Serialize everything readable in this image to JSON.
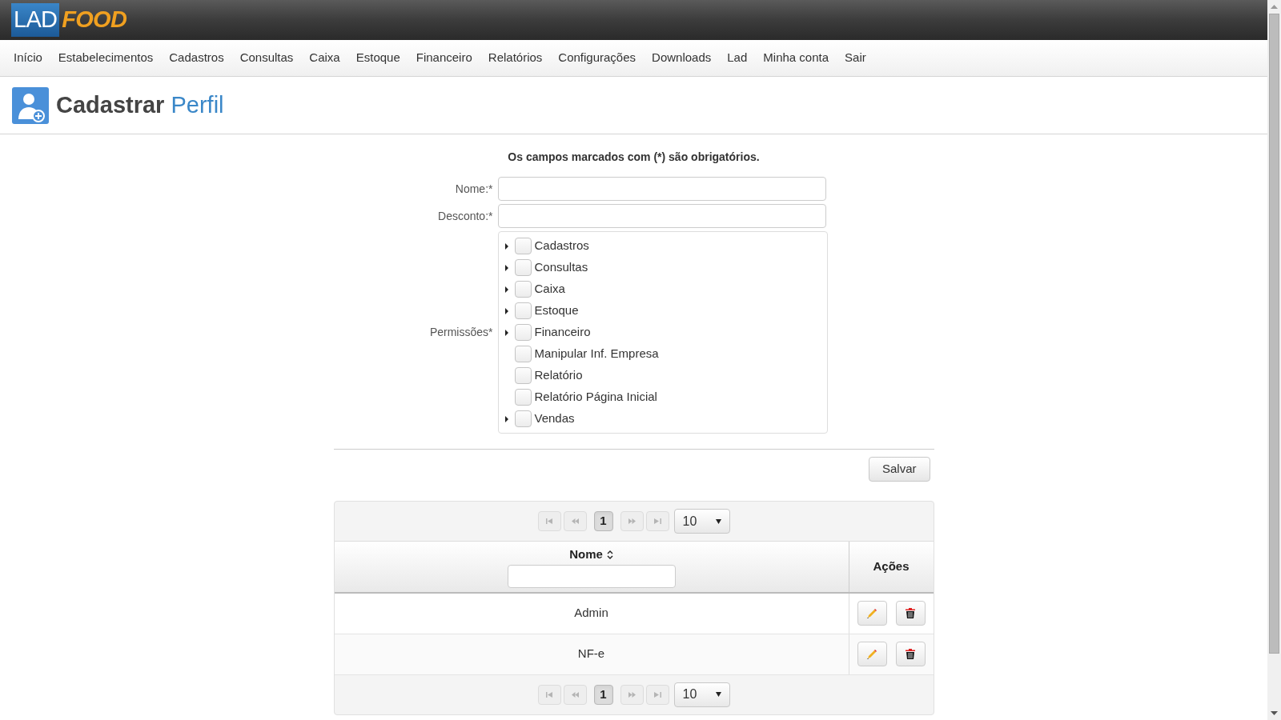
{
  "logo": {
    "part1": "LAD",
    "part2": "FOOD"
  },
  "nav": [
    "Início",
    "Estabelecimentos",
    "Cadastros",
    "Consultas",
    "Caixa",
    "Estoque",
    "Financeiro",
    "Relatórios",
    "Configurações",
    "Downloads",
    "Lad",
    "Minha conta",
    "Sair"
  ],
  "page_title": {
    "verb": "Cadastrar",
    "noun": "Perfil"
  },
  "form": {
    "notice": "Os campos marcados com (*) são obrigatórios.",
    "fields": [
      {
        "label": "Nome:*"
      },
      {
        "label": "Desconto:*"
      }
    ],
    "permissions_label": "Permissões*",
    "permissions": [
      {
        "label": "Cadastros",
        "expandable": true,
        "checked": false
      },
      {
        "label": "Consultas",
        "expandable": true,
        "checked": false
      },
      {
        "label": "Caixa",
        "expandable": true,
        "checked": false
      },
      {
        "label": "Estoque",
        "expandable": true,
        "checked": false
      },
      {
        "label": "Financeiro",
        "expandable": true,
        "checked": false
      },
      {
        "label": "Manipular Inf. Empresa",
        "expandable": false,
        "checked": false
      },
      {
        "label": "Relatório",
        "expandable": false,
        "checked": false
      },
      {
        "label": "Relatório Página Inicial",
        "expandable": false,
        "checked": false
      },
      {
        "label": "Vendas",
        "expandable": true,
        "checked": false
      }
    ],
    "save_button": "Salvar"
  },
  "table": {
    "pager_top": {
      "pages": [
        {
          "label": "1",
          "selected": true
        }
      ],
      "page_size": "10"
    },
    "columns": [
      "Nome",
      "Ações"
    ],
    "rows": [
      {
        "name": "Admin"
      },
      {
        "name": "NF-e"
      }
    ],
    "pager_bottom": {
      "pages": [
        {
          "label": "1",
          "selected": true
        }
      ],
      "page_size": "10"
    }
  }
}
